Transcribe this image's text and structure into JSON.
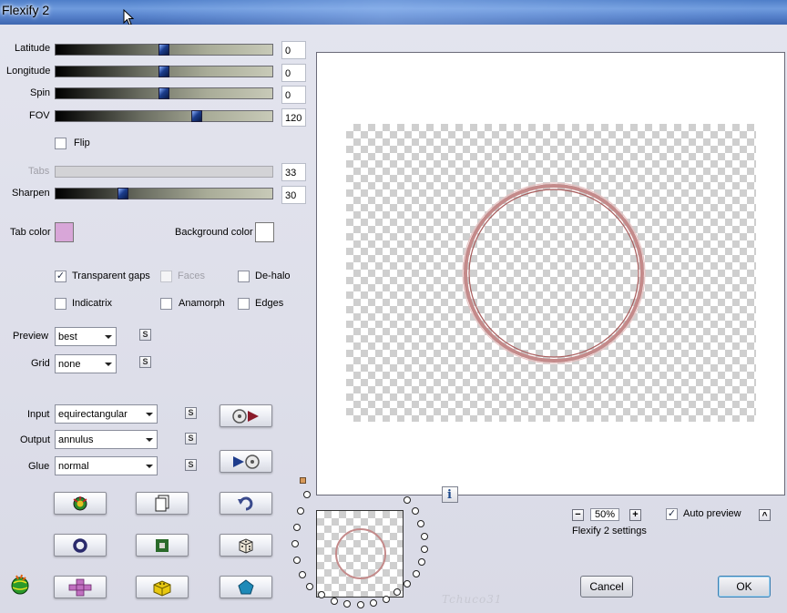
{
  "window": {
    "title": "Flexify 2"
  },
  "sliders": {
    "latitude": {
      "label": "Latitude",
      "value": "0",
      "fraction": 0.5
    },
    "longitude": {
      "label": "Longitude",
      "value": "0",
      "fraction": 0.5
    },
    "spin": {
      "label": "Spin",
      "value": "0",
      "fraction": 0.5
    },
    "fov": {
      "label": "FOV",
      "value": "120",
      "fraction": 0.66
    },
    "tabs": {
      "label": "Tabs",
      "value": "33",
      "fraction": 0.0
    },
    "sharpen": {
      "label": "Sharpen",
      "value": "30",
      "fraction": 0.3
    }
  },
  "flip": {
    "label": "Flip",
    "checked": false
  },
  "colors": {
    "tab_label": "Tab color",
    "tab_color": "#d8a6d8",
    "bg_label": "Background color",
    "bg_color": "#ffffff"
  },
  "options": {
    "transparent_gaps": {
      "label": "Transparent gaps",
      "checked": true
    },
    "faces": {
      "label": "Faces",
      "checked": false,
      "disabled": true
    },
    "de_halo": {
      "label": "De-halo",
      "checked": false
    },
    "indicatrix": {
      "label": "Indicatrix",
      "checked": false
    },
    "anamorph": {
      "label": "Anamorph",
      "checked": false
    },
    "edges": {
      "label": "Edges",
      "checked": false
    }
  },
  "selects": {
    "preview": {
      "label": "Preview",
      "value": "best"
    },
    "grid": {
      "label": "Grid",
      "value": "none"
    },
    "input": {
      "label": "Input",
      "value": "equirectangular"
    },
    "output": {
      "label": "Output",
      "value": "annulus"
    },
    "glue": {
      "label": "Glue",
      "value": "normal"
    }
  },
  "sync_glyph": "S",
  "icons": {
    "swap_input": "film-reel-play-icon",
    "swap_output": "play-film-reel-icon",
    "randomize": "sun-globe-icon",
    "document": "document-copy-icon",
    "undo": "undo-arrow-icon",
    "ring": "ring-shape-icon",
    "square": "square-frame-icon",
    "dice": "dice-icon",
    "cross": "cross-shape-icon",
    "cube": "yellow-cube-icon",
    "pentagon": "pentagon-shape-icon",
    "logo": "flexify-globe-logo-icon"
  },
  "zoom": {
    "minus": "−",
    "value": "50%",
    "plus": "+"
  },
  "auto_preview": {
    "label": "Auto preview",
    "checked": true,
    "caret": "^"
  },
  "info_glyph": "i",
  "settings_title": "Flexify 2 settings",
  "buttons": {
    "cancel": "Cancel",
    "ok": "OK"
  },
  "watermark": "Tchuco31"
}
